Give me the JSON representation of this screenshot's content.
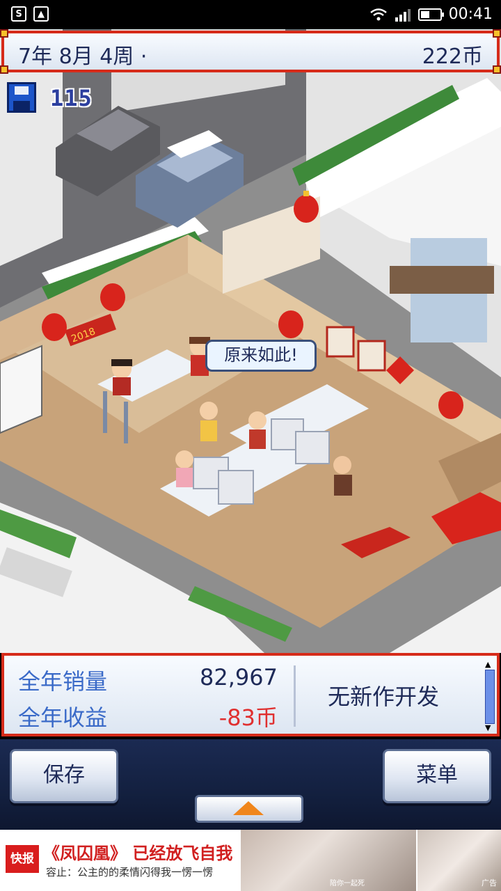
{
  "status_bar": {
    "time": "00:41",
    "icons": [
      "s-app-icon",
      "gallery-icon",
      "wifi-icon",
      "signal-icon",
      "battery-icon"
    ]
  },
  "hud": {
    "date": "7年 8月 4周 ·",
    "money": "222币",
    "save_count": "115"
  },
  "scene": {
    "speech_bubble": "原来如此!",
    "banner": "2018"
  },
  "stats": {
    "annual_sales_label": "全年销量",
    "annual_sales_value": "82,967",
    "annual_profit_label": "全年收益",
    "annual_profit_value": "-83币",
    "dev_status": "无新作开发"
  },
  "buttons": {
    "save": "保存",
    "menu": "菜单"
  },
  "ad": {
    "logo": "快报",
    "headline": "《凤囚凰》 已经放飞自我",
    "subline": "容止：公主的的柔情闪得我一愣一愣",
    "caption": "陪你一起死",
    "tag": "广告"
  },
  "colors": {
    "accent_red": "#d62b1a",
    "panel_blue": "#3a6ac8",
    "negative": "#e03030",
    "nav_bg": "#1b2a52"
  }
}
